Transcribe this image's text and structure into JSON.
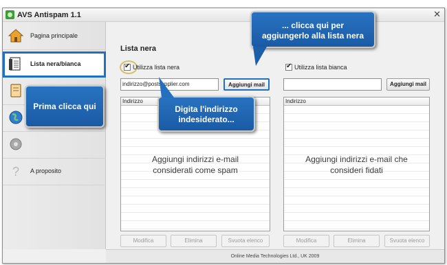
{
  "window": {
    "title": "AVS Antispam 1.1",
    "close_glyph": "✕"
  },
  "sidebar": {
    "items": [
      {
        "label": "Pagina principale",
        "icon": "home-icon"
      },
      {
        "label": "Lista nera/bianca",
        "icon": "list-icon"
      },
      {
        "label": "Giornale",
        "visible_label": "rnale",
        "icon": "journal-icon"
      },
      {
        "label": "",
        "icon": "globe-icon"
      },
      {
        "label": "",
        "icon": "gear-icon"
      },
      {
        "label": "A proposito",
        "icon": "question-icon"
      }
    ]
  },
  "blacklist": {
    "title": "Lista nera",
    "use_label": "Utilizza lista nera",
    "input_value": "indirizzo@postsupplier.com",
    "add_button": "Aggiungi mail",
    "column": "Indirizzo",
    "hint_line1": "Aggiungi indirizzi e-mail",
    "hint_line2": "considerati come spam",
    "buttons": [
      "Modifica",
      "Elimina",
      "Svuota elenco"
    ]
  },
  "whitelist": {
    "use_label": "Utilizza lista bianca",
    "input_value": "",
    "add_button": "Aggiungi mail",
    "column": "Indirizzo",
    "hint_line1": "Aggiungi indirizzi e-mail che",
    "hint_line2": "consideri fidati",
    "buttons": [
      "Modifica",
      "Elimina",
      "Svuota elenco"
    ]
  },
  "status_bar": "Online Media Technologies Ltd., UK 2009",
  "callouts": {
    "first": "Prima clicca qui",
    "type_line1": "Digita l'indirizzo",
    "type_line2": "indesiderato...",
    "click_line1": "... clicca qui per",
    "click_line2": "aggiungerlo alla lista nera"
  },
  "colors": {
    "accent": "#1f6fc2",
    "callout": "#2166b4"
  }
}
